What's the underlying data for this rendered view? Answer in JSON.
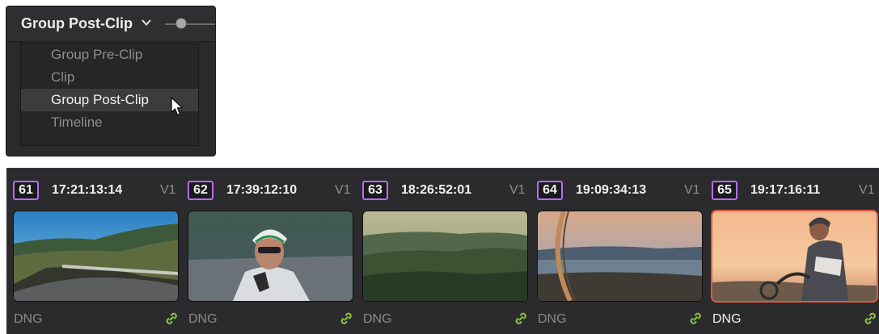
{
  "mode_selector": {
    "current": "Group Post-Clip",
    "options": [
      {
        "label": "Group Pre-Clip",
        "selected": false
      },
      {
        "label": "Clip",
        "selected": false
      },
      {
        "label": "Group Post-Clip",
        "selected": true
      },
      {
        "label": "Timeline",
        "selected": false
      }
    ]
  },
  "clips": [
    {
      "number": "61",
      "timecode": "17:21:13:14",
      "track": "V1",
      "format": "DNG",
      "thumbnail": "coastal-road",
      "selected": false
    },
    {
      "number": "62",
      "timecode": "17:39:12:10",
      "track": "V1",
      "format": "DNG",
      "thumbnail": "cyclist-closeup",
      "selected": false
    },
    {
      "number": "63",
      "timecode": "18:26:52:01",
      "track": "V1",
      "format": "DNG",
      "thumbnail": "hillside-shrubs",
      "selected": false
    },
    {
      "number": "64",
      "timecode": "19:09:34:13",
      "track": "V1",
      "format": "DNG",
      "thumbnail": "bay-view-wheel",
      "selected": false
    },
    {
      "number": "65",
      "timecode": "19:17:16:11",
      "track": "V1",
      "format": "DNG",
      "thumbnail": "cyclist-sunset",
      "selected": true
    }
  ],
  "icons": {
    "chevron": "chevron-down-icon",
    "cursor": "cursor-arrow-icon",
    "link": "link-icon"
  },
  "colors": {
    "clip_color": "#b96cf7",
    "selection": "#e2563d",
    "link": "#8ec63f"
  }
}
